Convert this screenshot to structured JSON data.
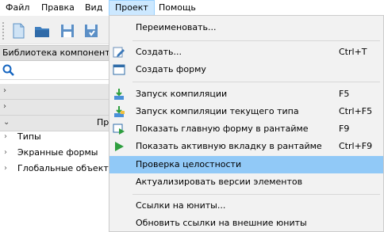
{
  "menubar": {
    "items": [
      "Файл",
      "Правка",
      "Вид",
      "Проект",
      "Помощь"
    ],
    "active_index": 3
  },
  "toolbar": {
    "buttons": [
      "new-doc-icon",
      "open-folder-icon",
      "save-icon",
      "save-as-icon"
    ]
  },
  "left_panel": {
    "title": "Библиотека компонентов",
    "search_icon": "search-icon",
    "section_label": "Пр",
    "tree": [
      "Типы",
      "Экранные формы",
      "Глобальные объекты"
    ]
  },
  "project_menu": {
    "items": [
      {
        "label": "Переименовать...",
        "shortcut": "",
        "icon": ""
      },
      {
        "label": "Создать...",
        "shortcut": "Ctrl+T",
        "icon": "edit-icon"
      },
      {
        "label": "Создать форму",
        "shortcut": "",
        "icon": "form-icon"
      },
      {
        "label": "Запуск компиляции",
        "shortcut": "F5",
        "icon": "compile-icon"
      },
      {
        "label": "Запуск компиляции текущего типа",
        "shortcut": "Ctrl+F5",
        "icon": "compile-type-icon"
      },
      {
        "label": "Показать главную форму в рантайме",
        "shortcut": "F9",
        "icon": "run-form-icon"
      },
      {
        "label": "Показать активную вкладку в рантайме",
        "shortcut": "Ctrl+F9",
        "icon": "run-tab-icon"
      },
      {
        "label": "Проверка целостности",
        "shortcut": "",
        "icon": ""
      },
      {
        "label": "Актуализировать версии элементов",
        "shortcut": "",
        "icon": ""
      },
      {
        "label": "Ссылки на юниты...",
        "shortcut": "",
        "icon": ""
      },
      {
        "label": "Обновить ссылки на внешние юниты",
        "shortcut": "",
        "icon": ""
      }
    ],
    "highlighted_index": 7
  }
}
